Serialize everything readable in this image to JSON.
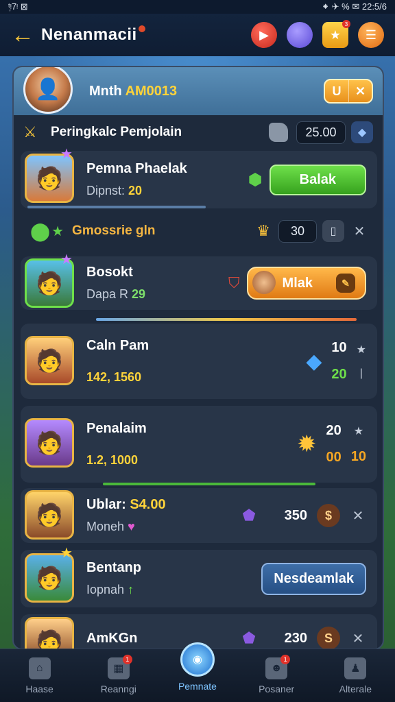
{
  "status_bar": {
    "left": "ᵗ᷊ᵎ7ᵎ ⊠",
    "right": "⁕ ✈ % ✉ 22:5/6"
  },
  "header": {
    "back_icon": "arrow-left-icon",
    "title": "Nenanmacii",
    "icons": [
      "play-icon",
      "orb-icon",
      "star-badge-icon",
      "menu-icon"
    ],
    "star_badge_count": "3"
  },
  "profile": {
    "name_prefix": "Mnth ",
    "name_highlight": "AM0013",
    "btn_a": "U",
    "btn_b": "✕"
  },
  "topline": {
    "label": "Peringkalc Pemjolain",
    "value": "25.00"
  },
  "rows": [
    {
      "name": "Pemna Phaelak",
      "sub_label": "Dipnst:",
      "sub_value": "20",
      "action": "Balak"
    },
    {
      "label": "Gmossrie gln",
      "value": "30"
    },
    {
      "name": "Bosokt",
      "sub_label": "Dapa R",
      "sub_value": "29",
      "action": "Mlak"
    },
    {
      "name": "Caln Pam",
      "sub_value": "142, 1560",
      "num_a": "10",
      "num_b": "20"
    },
    {
      "name": "Penalaim",
      "sub_value": "1.2, 1000",
      "num_a": "20",
      "num_b": "00",
      "num_c": "10"
    },
    {
      "name_prefix": "Ublar: ",
      "name_highlight": "S4.00",
      "sub_label": "Moneh",
      "value": "350",
      "coin": "$"
    },
    {
      "name": "Bentanp",
      "sub_label": "Iopnah",
      "action": "Nesdeamlak"
    },
    {
      "name": "AmKGn",
      "value": "230",
      "coin": "S"
    }
  ],
  "nav": [
    {
      "label": "Haase",
      "icon": "home-icon"
    },
    {
      "label": "Reanngi",
      "icon": "calendar-icon",
      "badge": "1"
    },
    {
      "label": "Pemnate",
      "icon": "center-orb-icon"
    },
    {
      "label": "Posaner",
      "icon": "mask-icon",
      "badge": "1"
    },
    {
      "label": "Alterale",
      "icon": "person-icon"
    }
  ]
}
